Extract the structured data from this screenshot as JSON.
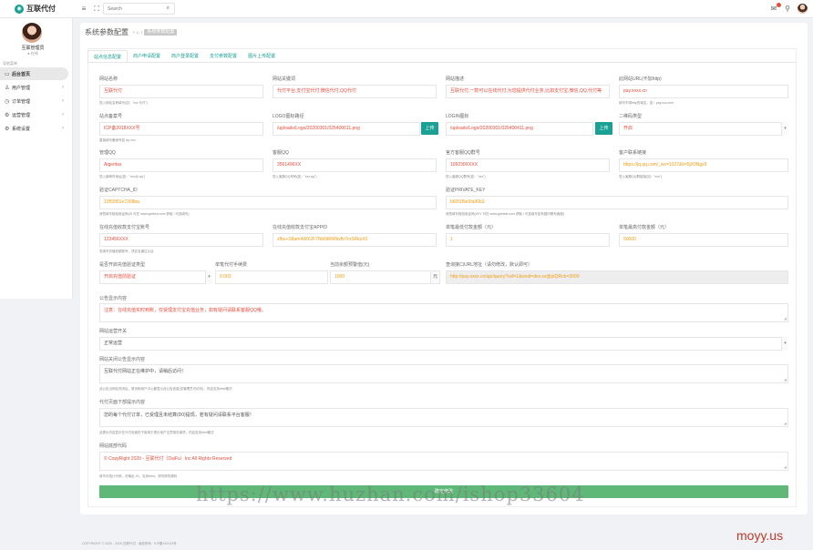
{
  "app": {
    "name": "互联代付",
    "logo_glyph": "◉"
  },
  "topbar": {
    "search_placeholder": "Search",
    "menu_icon": "hamburger-icon",
    "fullscreen_icon": "expand-icon",
    "notification_icon": "bell-icon",
    "help_icon": "question-icon"
  },
  "sidebar": {
    "user_name": "互联管理员",
    "user_role": "● 在线",
    "nav_heading": "导航菜单",
    "items": [
      {
        "label": "后台首页",
        "icon": "monitor-icon",
        "active": true
      },
      {
        "label": "用户管理",
        "icon": "user-icon",
        "active": false
      },
      {
        "label": "订单管理",
        "icon": "clock-icon",
        "active": false
      },
      {
        "label": "运营管理",
        "icon": "settings-icon",
        "active": false
      },
      {
        "label": "系统设置",
        "icon": "gear-icon",
        "active": false
      }
    ]
  },
  "page": {
    "title": "系统参数配置",
    "crumb_home": "⌂",
    "crumb_current": "系统参数配置"
  },
  "tabs": [
    "站点信息配置",
    "商户申请配置",
    "商户登录配置",
    "支付参数配置",
    "图片上传配置"
  ],
  "row1": [
    {
      "label": "网站名称",
      "value": "互联代付",
      "help": "您入网站名称填写(如：\"xxx 代付\")"
    },
    {
      "label": "网站关键词",
      "value": "代付平台,支付宝代付,微信代付,QQ代付",
      "help": ""
    },
    {
      "label": "网站描述",
      "value": "互联代付,一款可以在线代付,为您提供代付业务,比如支付宝,微信,QQ,代付等",
      "help": ""
    },
    {
      "label": "此网站URL(不加http)",
      "value": "pay.xxxx.cn",
      "help": "填写不带http的域名，如：pay.xxx.com"
    }
  ],
  "row2": [
    {
      "label": "站点备案号",
      "value": "ICP备2018XXX号",
      "help": "直接填写备案号如 icp xxx"
    },
    {
      "label": "LOGO图标路径",
      "value": "/uploads/Logo/20200301/025400611.png",
      "button": "上传"
    },
    {
      "label": "LOGIN图标",
      "value": "/uploads/Logo/20200301/025400411.png",
      "button": "上传"
    },
    {
      "label": "二维码类型",
      "value": "开启",
      "caret": "▾"
    }
  ],
  "row3": [
    {
      "label": "管理QQ",
      "value": "Aigeritas",
      "help": "您入新邮件地址(如：\"xxx@.qq\")"
    },
    {
      "label": "客服QQ",
      "value": "3561496XX",
      "help": "您入客服QQ号码(如：\"xxx.qq\")"
    },
    {
      "label": "官方客服QQ群号",
      "value": "109230XXXX",
      "help": "您入客服QQ群号(如：\"xxx\")"
    },
    {
      "label": "客户联系链接",
      "value": "https://jq.qq.com/_wv=1027&k=5jX9Ngx9",
      "help": "您入客服QQ群链接(如：\"xxx\")"
    }
  ],
  "row4": [
    {
      "label": "验证CAPTCHA_ID",
      "value": "10f55f91e7308ba",
      "help": "请您填写极验验证码(ID 可在 www.geetest.com 获取 / 可选填写)"
    },
    {
      "label": "验证PRIVATE_KEY",
      "value": "b60f1f9e5fa96b3",
      "help": "请您填写极验验证码(KEY 可在 www.geetest.com 获取 / 可选填写如有疑问联系客服)"
    }
  ],
  "row5": [
    {
      "label": "在线充值收款支付宝账号",
      "value": "123456XXX",
      "help": "您填写充值收款账号，须实名通过认证"
    },
    {
      "label": "在线充值收款支付宝APPID",
      "value": "zfbu+S8am4WX2F7NbNtRWbvfb7rnSRkzX0",
      "help": ""
    },
    {
      "label": "单笔最低付款金额（元）",
      "value": "1",
      "help": ""
    },
    {
      "label": "单笔最高付款金额（元）",
      "value": "50000",
      "help": ""
    }
  ],
  "row6": [
    {
      "label": "是否开启充值验证类型",
      "value": "开启充值前验证",
      "caret": "▾"
    },
    {
      "label": "单笔代付手续费",
      "value": "0.003",
      "help": ""
    },
    {
      "label": "当前余额预警值(元)",
      "value": "1000",
      "unit": "元"
    },
    {
      "label": "查询接口URL地址（请勿修改，默认即可）",
      "value": "http://pay.xxxx.cn/api/query?sid=1&wxid=dev.xx@ptQRcb=2000"
    }
  ],
  "areas": [
    {
      "label": "公告显示内容",
      "value": "注意：在线充值实时到账，仅受理支付宝充值业务，如有疑问请联系客服QQ哦。",
      "style": "red"
    },
    {
      "label": "网站运营开关",
      "value": "正常运营",
      "caret": "▾",
      "style": "select"
    },
    {
      "label": "网站关闭公告显示内容",
      "value": "互联代付网站正在维护中，请稍后访问！",
      "help": "此公告当网站关闭后，首页和用户中心都显示此公告信息(仅管理员可访问)，内容支持html格式",
      "style": "dark"
    },
    {
      "label": "代付页面下部提示内容",
      "value": "您的每个代付订单，已受理且未结算(D0)提现，若有疑问请联系平台客服！",
      "help": "此提示内容显示在代付页面的下部用于提示用户注意相关事项，内容支持html格式",
      "style": "dark"
    },
    {
      "label": "网站底部代码",
      "value": "© CopyRight 2020 - 互联代付（DaiFu）Inc All Rights Reserved",
      "help": "填写可统计代码，可输出 JS，支持html。请勿修改源码",
      "style": "red"
    }
  ],
  "submit_label": "确定修改",
  "footer": "COPYRIGHT © 2020 - 2025 互联代付 - 版权所有 · ICP备XXXXX号",
  "watermark": "https://www.huzhan.com/ishop33604",
  "watermark2": "moyy.us"
}
